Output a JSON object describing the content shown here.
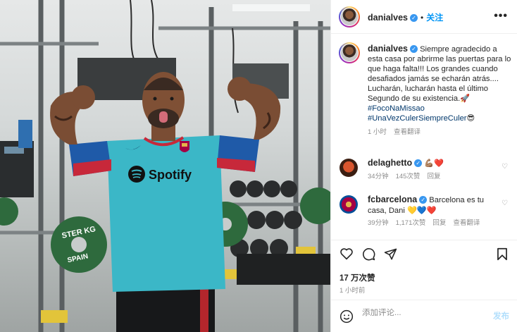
{
  "post": {
    "username": "danialves",
    "follow_label": "关注",
    "more_label": "•••"
  },
  "caption": {
    "text": "Siempre agradecido a esta casa por abrirme las puertas para lo que haga falta!!! Los grandes cuando desafiados jamás se echarán atrás.... Lucharán, lucharán hasta el último Segundo de su existencia.",
    "emoji_after_text": "🚀",
    "hashtag_1": "#FocoNaMissao",
    "hashtag_2": "#UnaVezCulerSiempreCuler",
    "emoji_after_hashtag": "😎",
    "time": "1 小时",
    "see_translation": "查看翻译"
  },
  "comments": [
    {
      "username": "delaghetto",
      "text": "💪🏽❤️",
      "time": "34分钟",
      "likes": "145次赞",
      "reply": "回复"
    },
    {
      "username": "fcbarcelona",
      "text": "Barcelona es tu casa, Dani 💛💙❤️",
      "time": "39分钟",
      "likes": "1,171次赞",
      "reply": "回复",
      "see_translation": "查看翻译"
    }
  ],
  "stats": {
    "likes": "17 万次赞",
    "time_ago": "1 小时前"
  },
  "add_comment": {
    "placeholder": "添加评论...",
    "post_label": "发布"
  },
  "photo": {
    "shirt_brand": "Spotify",
    "plate_text": "STER KG",
    "plate_text_2": "SPAIN"
  },
  "colors": {
    "shirt": "#3bb7c7",
    "shirt_sleeve": "#1f5aa8",
    "verified": "#3897f0",
    "follow": "#0095f6",
    "plate": "#2e6a3d"
  }
}
